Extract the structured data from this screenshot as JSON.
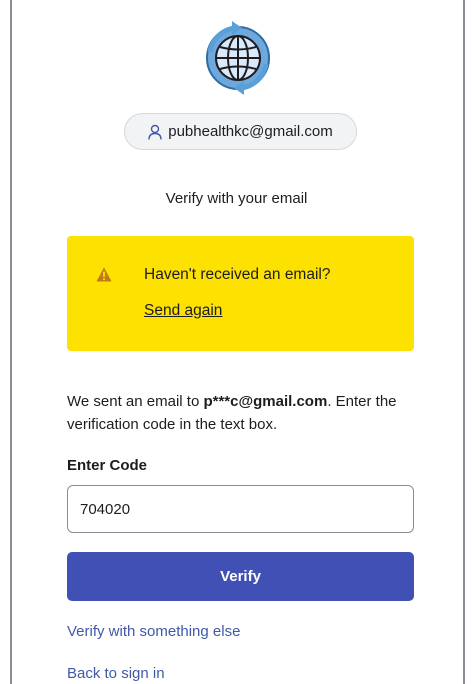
{
  "identifier": {
    "email": "pubhealthkc@gmail.com",
    "icon": "user-icon"
  },
  "logo": {
    "icon": "globe-sync-icon"
  },
  "title": "Verify with your email",
  "callout": {
    "icon": "warning-icon",
    "heading": "Haven't received an email?",
    "send_again": "Send again"
  },
  "instructions": {
    "prefix": "We sent an email to ",
    "masked_email": "p***c@gmail.com",
    "suffix": ". Enter the verification code in the text box."
  },
  "code": {
    "label": "Enter Code",
    "value": "704020"
  },
  "buttons": {
    "verify": "Verify"
  },
  "links": {
    "verify_other": "Verify with something else",
    "back": "Back to sign in"
  },
  "colors": {
    "accent": "#4150b4",
    "callout_bg": "#fde100",
    "link": "#3f59a8"
  }
}
